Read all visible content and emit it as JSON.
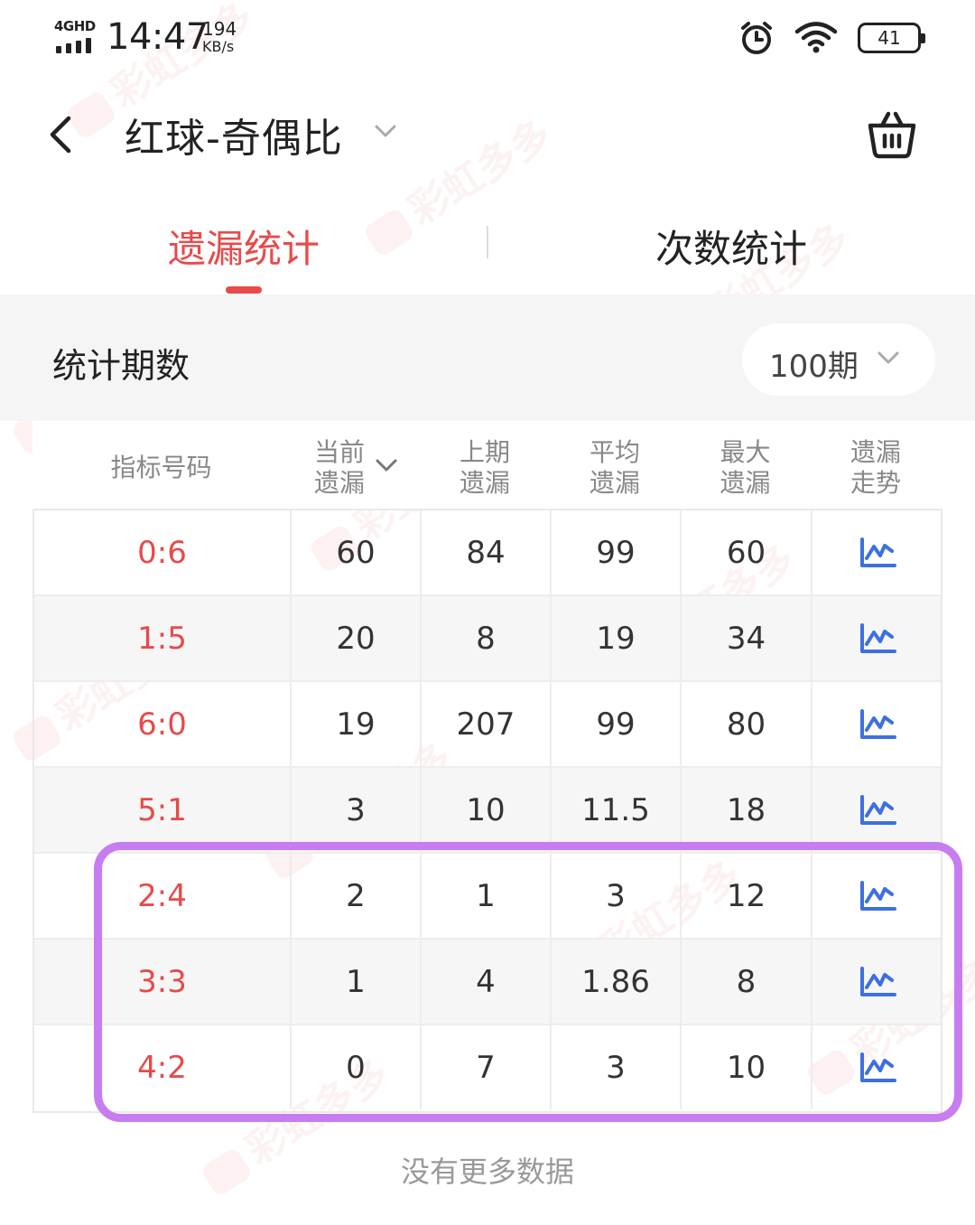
{
  "status_bar": {
    "network": "4GHD",
    "time": "14:47",
    "speed_value": "194",
    "speed_unit": "KB/s",
    "battery": "41",
    "icons": [
      "alarm-icon",
      "wifi-icon",
      "battery-icon"
    ]
  },
  "header": {
    "title": "红球-奇偶比",
    "back_icon": "back-arrow-icon",
    "dropdown_icon": "chevron-down-icon",
    "cart_icon": "basket-icon"
  },
  "tabs": [
    {
      "label": "遗漏统计",
      "active": true
    },
    {
      "label": "次数统计",
      "active": false
    }
  ],
  "stats_period": {
    "label": "统计期数",
    "selected": "100期"
  },
  "table": {
    "headers": [
      {
        "line1": "指标号码",
        "line2": ""
      },
      {
        "line1": "当前",
        "line2": "遗漏"
      },
      {
        "line1": "上期",
        "line2": "遗漏"
      },
      {
        "line1": "平均",
        "line2": "遗漏"
      },
      {
        "line1": "最大",
        "line2": "遗漏"
      },
      {
        "line1": "遗漏",
        "line2": "走势"
      }
    ],
    "rows": [
      {
        "ratio": "0:6",
        "current": "60",
        "previous": "84",
        "average": "99",
        "max": "60"
      },
      {
        "ratio": "1:5",
        "current": "20",
        "previous": "8",
        "average": "19",
        "max": "34"
      },
      {
        "ratio": "6:0",
        "current": "19",
        "previous": "207",
        "average": "99",
        "max": "80"
      },
      {
        "ratio": "5:1",
        "current": "3",
        "previous": "10",
        "average": "11.5",
        "max": "18"
      },
      {
        "ratio": "2:4",
        "current": "2",
        "previous": "1",
        "average": "3",
        "max": "12"
      },
      {
        "ratio": "3:3",
        "current": "1",
        "previous": "4",
        "average": "1.86",
        "max": "8"
      },
      {
        "ratio": "4:2",
        "current": "0",
        "previous": "7",
        "average": "3",
        "max": "10"
      }
    ],
    "trend_icon": "trend-chart-icon"
  },
  "footer_text": "没有更多数据",
  "watermark_text": "彩虹多多",
  "colors": {
    "accent": "#e84a4a",
    "highlight_border": "#c77cf0",
    "trend_icon": "#3d6fe0"
  }
}
